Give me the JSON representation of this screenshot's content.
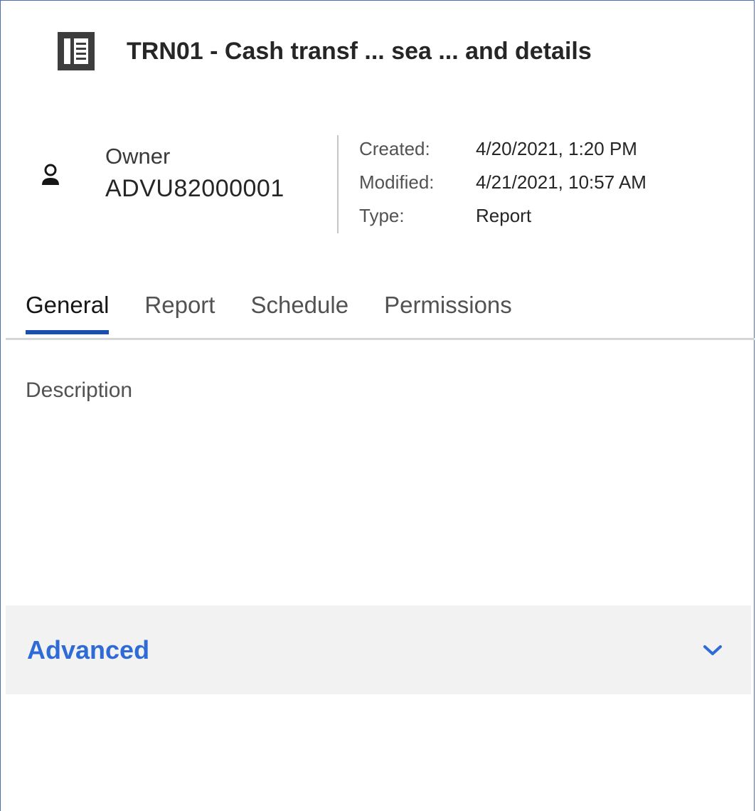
{
  "header": {
    "title": "TRN01 - Cash transf ... sea ... and details",
    "icon": "report-icon"
  },
  "owner": {
    "icon": "user-icon",
    "label": "Owner",
    "value": "ADVU82000001"
  },
  "meta": [
    {
      "key": "Created:",
      "value": "4/20/2021, 1:20 PM"
    },
    {
      "key": "Modified:",
      "value": "4/21/2021, 10:57 AM"
    },
    {
      "key": "Type:",
      "value": "Report"
    }
  ],
  "tabs": [
    {
      "label": "General",
      "active": true
    },
    {
      "label": "Report",
      "active": false
    },
    {
      "label": "Schedule",
      "active": false
    },
    {
      "label": "Permissions",
      "active": false
    }
  ],
  "general": {
    "description_label": "Description"
  },
  "advanced": {
    "label": "Advanced",
    "icon": "chevron-down-icon"
  },
  "colors": {
    "accent": "#2f6bd6",
    "tab_indicator": "#1a4fb0",
    "panel_bg": "#f2f2f2",
    "frame_border": "#4a6fb5"
  }
}
